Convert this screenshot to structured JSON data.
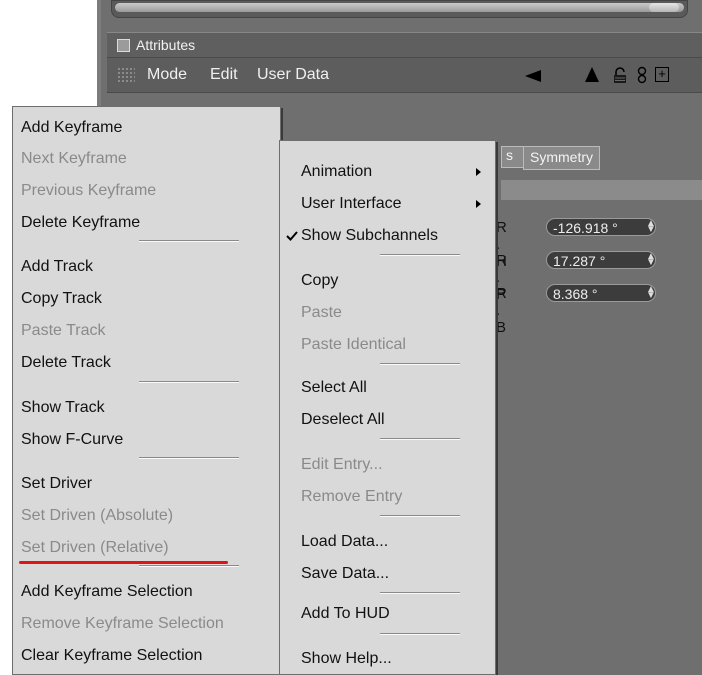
{
  "panel": {
    "title": "Attributes",
    "menubar": [
      "Mode",
      "Edit",
      "User Data"
    ]
  },
  "tabs": {
    "partial": "s",
    "symmetry": "Symmetry"
  },
  "coords": [
    {
      "label": "R . H",
      "value": "-126.918 °"
    },
    {
      "label": "R . P",
      "value": "17.287 °"
    },
    {
      "label": "R . B",
      "value": "8.368 °"
    }
  ],
  "left_menu": [
    {
      "label": "Add Keyframe",
      "enabled": true
    },
    {
      "label": "Next Keyframe",
      "enabled": false
    },
    {
      "label": "Previous Keyframe",
      "enabled": false
    },
    {
      "label": "Delete Keyframe",
      "enabled": true
    },
    {
      "label": "Add Track",
      "enabled": true
    },
    {
      "label": "Copy Track",
      "enabled": true
    },
    {
      "label": "Paste Track",
      "enabled": false
    },
    {
      "label": "Delete Track",
      "enabled": true
    },
    {
      "label": "Show Track",
      "enabled": true
    },
    {
      "label": "Show F-Curve",
      "enabled": true
    },
    {
      "label": "Set Driver",
      "enabled": true
    },
    {
      "label": "Set Driven (Absolute)",
      "enabled": false
    },
    {
      "label": "Set Driven (Relative)",
      "enabled": false
    },
    {
      "label": "Add Keyframe Selection",
      "enabled": true
    },
    {
      "label": "Remove Keyframe Selection",
      "enabled": false
    },
    {
      "label": "Clear Keyframe Selection",
      "enabled": true
    }
  ],
  "sub_menu": [
    {
      "label": "Animation",
      "enabled": true,
      "submenu": true
    },
    {
      "label": "User Interface",
      "enabled": true,
      "submenu": true
    },
    {
      "label": "Show Subchannels",
      "enabled": true,
      "checked": true
    },
    {
      "label": "Copy",
      "enabled": true
    },
    {
      "label": "Paste",
      "enabled": false
    },
    {
      "label": "Paste Identical",
      "enabled": false
    },
    {
      "label": "Select All",
      "enabled": true
    },
    {
      "label": "Deselect All",
      "enabled": true
    },
    {
      "label": "Edit Entry...",
      "enabled": false
    },
    {
      "label": "Remove Entry",
      "enabled": false
    },
    {
      "label": "Load Data...",
      "enabled": true
    },
    {
      "label": "Save Data...",
      "enabled": true
    },
    {
      "label": "Add To HUD",
      "enabled": true
    },
    {
      "label": "Show Help...",
      "enabled": true
    }
  ],
  "colors": {
    "highlight_underline": "#e01414",
    "menu_bg": "#d9d9d9",
    "disabled_text": "#8a8a8a"
  }
}
